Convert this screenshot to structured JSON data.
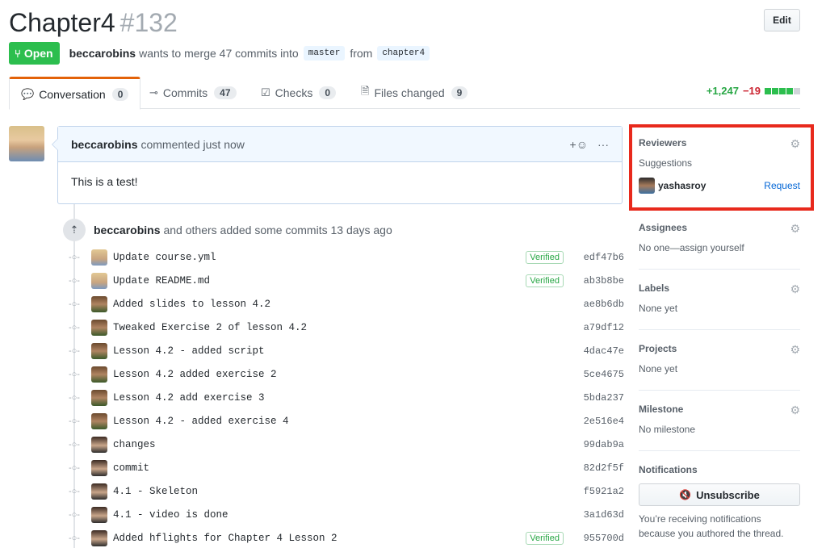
{
  "header": {
    "title": "Chapter4",
    "number": "#132",
    "edit_label": "Edit"
  },
  "meta": {
    "state": "Open",
    "author": "beccarobins",
    "text_mid": "wants to merge 47 commits into",
    "base_branch": "master",
    "text_from": "from",
    "head_branch": "chapter4"
  },
  "tabs": [
    {
      "label": "Conversation",
      "count": "0"
    },
    {
      "label": "Commits",
      "count": "47"
    },
    {
      "label": "Checks",
      "count": "0"
    },
    {
      "label": "Files changed",
      "count": "9"
    }
  ],
  "diffstat": {
    "additions": "+1,247",
    "deletions": "−19"
  },
  "comment": {
    "author": "beccarobins",
    "meta": "commented just now",
    "body": "This is a test!",
    "reaction_icon": "+☺",
    "more_icon": "···"
  },
  "commit_group": {
    "author": "beccarobins",
    "text": "and others added some commits 13 days ago"
  },
  "commits": [
    {
      "message": "Update course.yml",
      "verified": "Verified",
      "sha": "edf47b6",
      "avatar": "a1"
    },
    {
      "message": "Update README.md",
      "verified": "Verified",
      "sha": "ab3b8be",
      "avatar": "a1"
    },
    {
      "message": "Added slides to lesson 4.2",
      "verified": "",
      "sha": "ae8b6db",
      "avatar": "a2"
    },
    {
      "message": "Tweaked Exercise 2 of lesson 4.2",
      "verified": "",
      "sha": "a79df12",
      "avatar": "a2"
    },
    {
      "message": "Lesson 4.2 - added script",
      "verified": "",
      "sha": "4dac47e",
      "avatar": "a2"
    },
    {
      "message": "Lesson 4.2 added exercise 2",
      "verified": "",
      "sha": "5ce4675",
      "avatar": "a2"
    },
    {
      "message": "Lesson 4.2 add exercise 3",
      "verified": "",
      "sha": "5bda237",
      "avatar": "a2"
    },
    {
      "message": "Lesson 4.2 - added exercise 4",
      "verified": "",
      "sha": "2e516e4",
      "avatar": "a2"
    },
    {
      "message": "changes",
      "verified": "",
      "sha": "99dab9a",
      "avatar": "a3"
    },
    {
      "message": "commit",
      "verified": "",
      "sha": "82d2f5f",
      "avatar": "a3"
    },
    {
      "message": "4.1 - Skeleton",
      "verified": "",
      "sha": "f5921a2",
      "avatar": "a3"
    },
    {
      "message": "4.1 - video is done",
      "verified": "",
      "sha": "3a1d63d",
      "avatar": "a3"
    },
    {
      "message": "Added hflights for Chapter 4 Lesson 2",
      "verified": "Verified",
      "sha": "955700d",
      "avatar": "a3"
    }
  ],
  "sidebar": {
    "reviewers": {
      "title": "Reviewers",
      "suggestions": "Suggestions",
      "user": "yashasroy",
      "request": "Request"
    },
    "assignees": {
      "title": "Assignees",
      "value": "No one—assign yourself"
    },
    "labels": {
      "title": "Labels",
      "value": "None yet"
    },
    "projects": {
      "title": "Projects",
      "value": "None yet"
    },
    "milestone": {
      "title": "Milestone",
      "value": "No milestone"
    },
    "notifications": {
      "title": "Notifications",
      "button": "Unsubscribe",
      "button_icon": "🔇",
      "text": "You’re receiving notifications because you authored the thread."
    }
  },
  "colors": {
    "accent": "#0366d6",
    "open": "#2cbe4e",
    "highlight": "#e8291c"
  }
}
